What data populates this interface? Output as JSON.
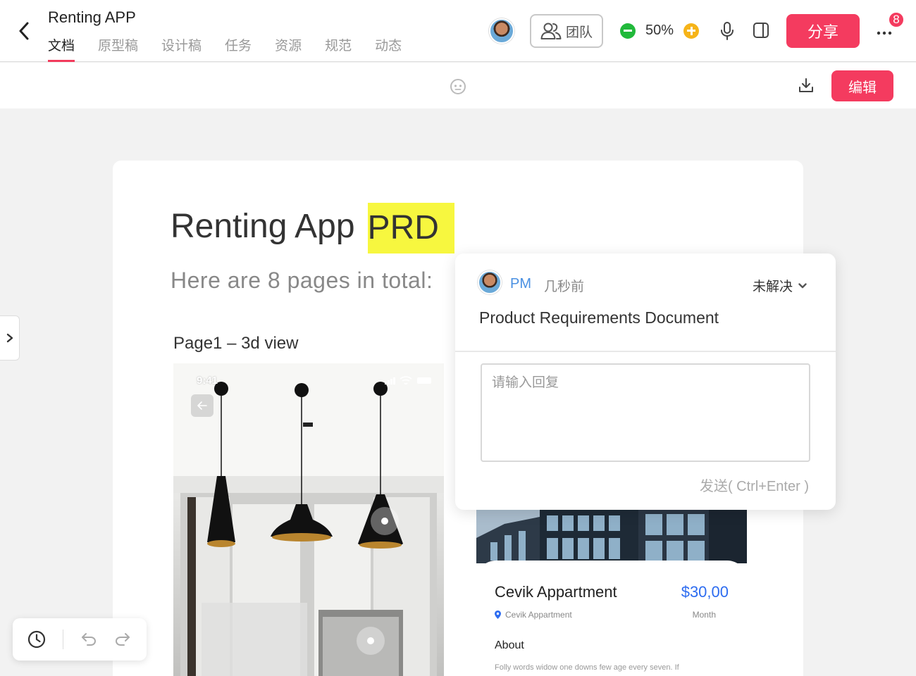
{
  "header": {
    "app_title": "Renting APP",
    "tabs": [
      {
        "label": "文档",
        "active": true
      },
      {
        "label": "原型稿",
        "active": false
      },
      {
        "label": "设计稿",
        "active": false
      },
      {
        "label": "任务",
        "active": false
      },
      {
        "label": "资源",
        "active": false
      },
      {
        "label": "规范",
        "active": false
      },
      {
        "label": "动态",
        "active": false
      }
    ],
    "team_label": "团队",
    "zoom": "50%",
    "share_label": "分享",
    "notification_count": "8",
    "accent_color": "#f43b5f"
  },
  "toolbar": {
    "edit_label": "编辑"
  },
  "document": {
    "title_plain": "Renting App",
    "title_highlight": "PRD",
    "subtitle": "Here are 8 pages in total:",
    "page1_label": "Page1 – 3d view",
    "screen1": {
      "time": "9:41"
    },
    "screen2": {
      "name": "Cevik Appartment",
      "price": "$30,00",
      "location": "Cevik Appartment",
      "period": "Month",
      "about_heading": "About",
      "about_text": "Folly words widow one downs few age every seven. If"
    }
  },
  "comment": {
    "user": "PM",
    "time": "几秒前",
    "status": "未解决",
    "text": "Product Requirements Document",
    "reply_placeholder": "请输入回复",
    "send_label": "发送( Ctrl+Enter )"
  },
  "icons": [
    "back-icon",
    "team-icon",
    "mic-icon",
    "panel-icon",
    "more-icon",
    "smile-icon",
    "download-icon",
    "history-icon",
    "undo-icon",
    "redo-icon",
    "chevron-right-icon",
    "chevron-down-icon",
    "location-icon"
  ]
}
